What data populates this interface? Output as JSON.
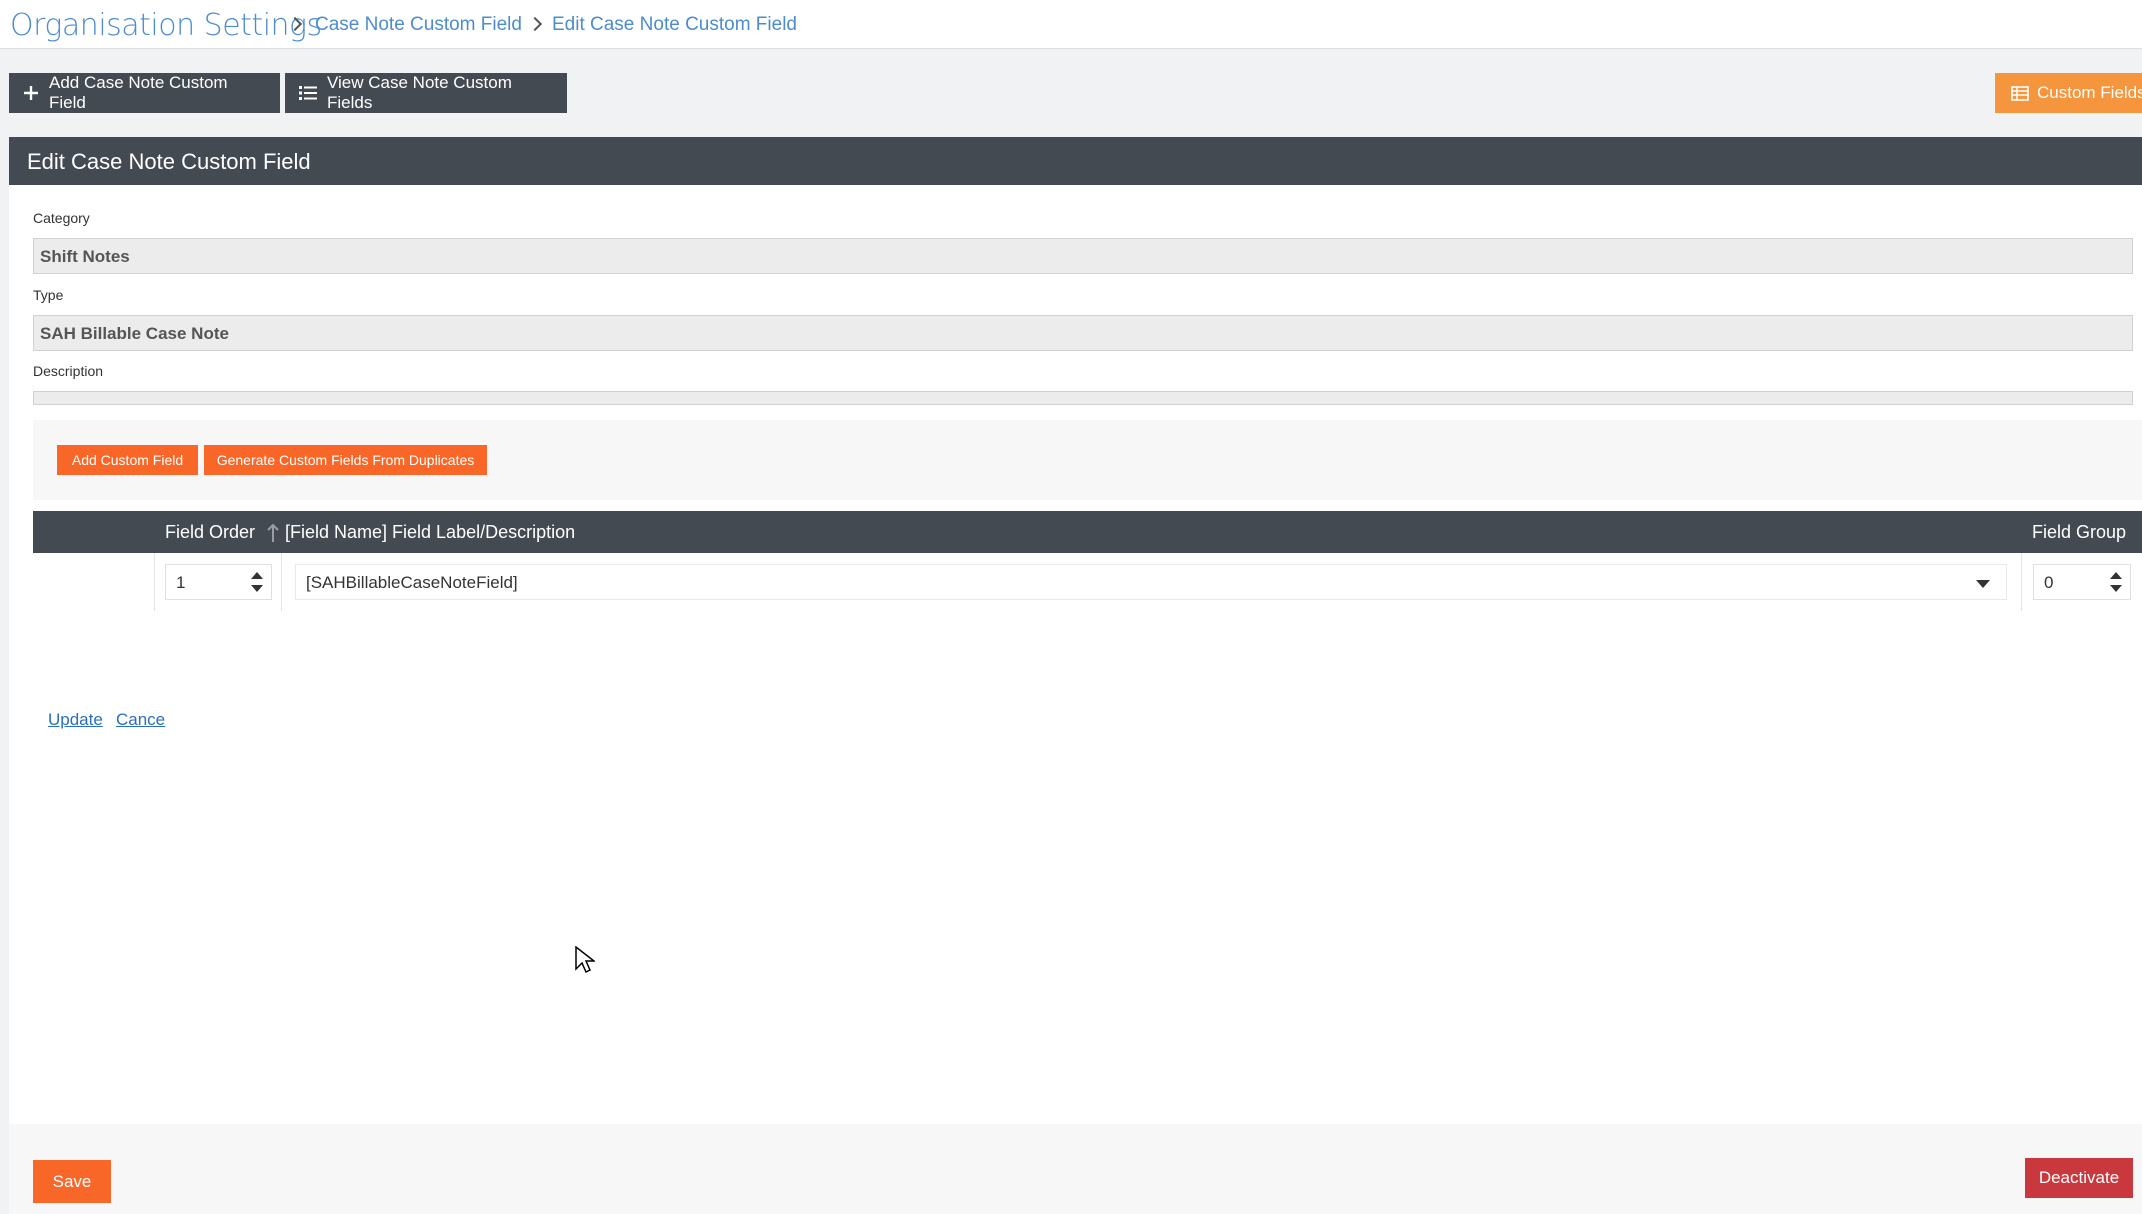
{
  "header": {
    "title": "Organisation Settings",
    "breadcrumbs": [
      "Case Note Custom Field",
      "Edit Case Note Custom Field"
    ]
  },
  "toolbar": {
    "add_label": "Add Case Note Custom Field",
    "view_label": "View Case Note Custom Fields",
    "custom_fields_label": "Custom Fields"
  },
  "panel": {
    "title": "Edit Case Note Custom Field",
    "category_label": "Category",
    "category_value": "Shift Notes",
    "type_label": "Type",
    "type_value": "SAH Billable Case Note",
    "description_label": "Description",
    "description_value": ""
  },
  "actions": {
    "add_custom_field": "Add Custom Field",
    "generate_from_duplicates": "Generate Custom Fields From Duplicates"
  },
  "grid": {
    "columns": {
      "field_order": "Field Order",
      "field_name": "[Field Name] Field Label/Description",
      "field_group": "Field Group"
    },
    "row": {
      "update_label": "Update",
      "cancel_label": "Cance",
      "field_order": "1",
      "field_name": "[SAHBillableCaseNoteField]",
      "field_group": "0"
    }
  },
  "footer": {
    "save_label": "Save",
    "deactivate_label": "Deactivate"
  },
  "colors": {
    "accent_orange": "#f86727",
    "header_dark": "#444a52",
    "link_blue": "#4e8ccd",
    "deactivate_red": "#c9383d"
  }
}
